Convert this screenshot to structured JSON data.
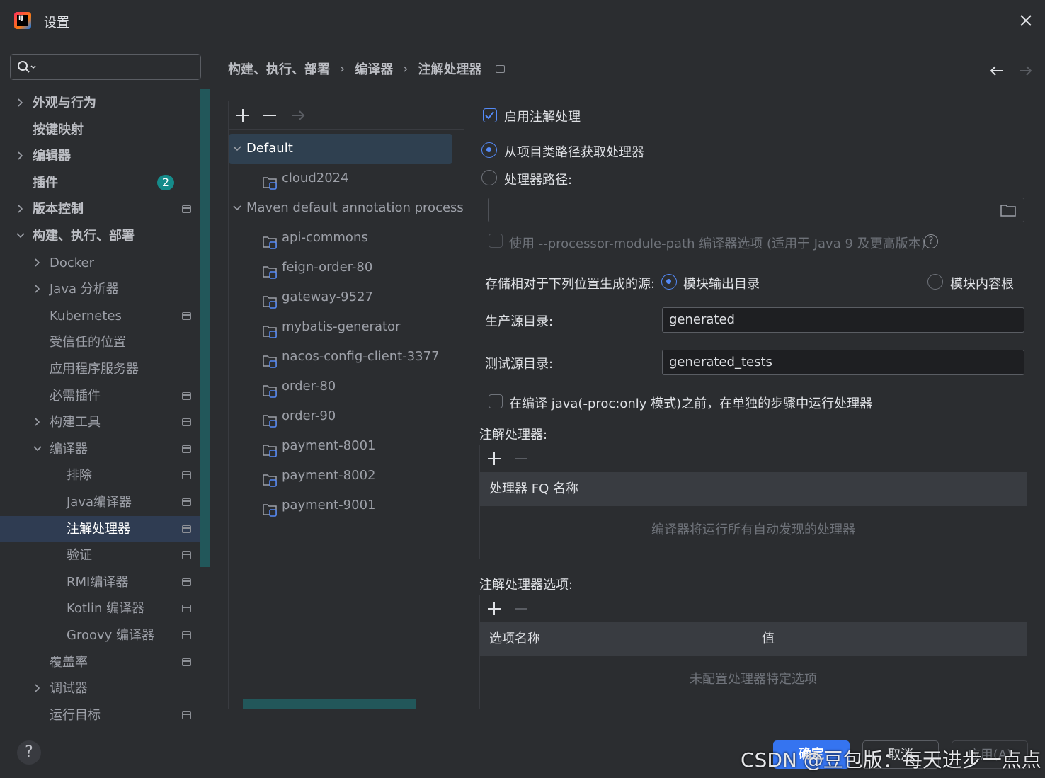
{
  "window": {
    "title": "设置",
    "app_icon": "intellij-idea-icon",
    "close_icon": "close-icon"
  },
  "colors": {
    "accent": "#3574f0",
    "badge": "#158b8a",
    "background": "#2b2d30",
    "selection": "#2f3c52"
  },
  "search": {
    "placeholder": "",
    "icon": "search-icon"
  },
  "sidebar": {
    "items": [
      {
        "label": "外观与行为",
        "expandable": true,
        "expanded": false,
        "level": 0
      },
      {
        "label": "按键映射",
        "expandable": false,
        "level": 0
      },
      {
        "label": "编辑器",
        "expandable": true,
        "expanded": false,
        "level": 0
      },
      {
        "label": "插件",
        "expandable": false,
        "level": 0,
        "badge": "2"
      },
      {
        "label": "版本控制",
        "expandable": true,
        "expanded": false,
        "level": 0,
        "pin": true
      },
      {
        "label": "构建、执行、部署",
        "expandable": true,
        "expanded": true,
        "level": 0
      },
      {
        "label": "Docker",
        "expandable": true,
        "expanded": false,
        "level": 1
      },
      {
        "label": "Java 分析器",
        "expandable": true,
        "expanded": false,
        "level": 1
      },
      {
        "label": "Kubernetes",
        "expandable": false,
        "level": 1,
        "pin": true
      },
      {
        "label": "受信任的位置",
        "expandable": false,
        "level": 1
      },
      {
        "label": "应用程序服务器",
        "expandable": false,
        "level": 1
      },
      {
        "label": "必需插件",
        "expandable": false,
        "level": 1,
        "pin": true
      },
      {
        "label": "构建工具",
        "expandable": true,
        "expanded": false,
        "level": 1,
        "pin": true
      },
      {
        "label": "编译器",
        "expandable": true,
        "expanded": true,
        "level": 1,
        "pin": true
      },
      {
        "label": "排除",
        "expandable": false,
        "level": 2,
        "pin": true
      },
      {
        "label": "Java编译器",
        "expandable": false,
        "level": 2,
        "pin": true
      },
      {
        "label": "注解处理器",
        "expandable": false,
        "level": 2,
        "pin": true,
        "selected": true
      },
      {
        "label": "验证",
        "expandable": false,
        "level": 2,
        "pin": true
      },
      {
        "label": "RMI编译器",
        "expandable": false,
        "level": 2,
        "pin": true
      },
      {
        "label": "Kotlin 编译器",
        "expandable": false,
        "level": 2,
        "pin": true
      },
      {
        "label": "Groovy 编译器",
        "expandable": false,
        "level": 2,
        "pin": true
      },
      {
        "label": "覆盖率",
        "expandable": false,
        "level": 1,
        "pin": true
      },
      {
        "label": "调试器",
        "expandable": true,
        "expanded": false,
        "level": 1
      },
      {
        "label": "运行目标",
        "expandable": false,
        "level": 1,
        "pin": true
      }
    ]
  },
  "breadcrumb": {
    "items": [
      "构建、执行、部署",
      "编译器",
      "注解处理器"
    ],
    "separator": "›"
  },
  "nav": {
    "back_icon": "arrow-left-icon",
    "forward_icon": "arrow-right-icon"
  },
  "profiles": {
    "toolbar": [
      "plus-icon",
      "minus-icon",
      "move-arrow-icon"
    ],
    "rows": [
      {
        "label": "Default",
        "type": "group",
        "expanded": true,
        "selected": true
      },
      {
        "label": "cloud2024",
        "type": "module"
      },
      {
        "label": "Maven default annotation processor",
        "type": "group",
        "expanded": true
      },
      {
        "label": "api-commons",
        "type": "module"
      },
      {
        "label": "feign-order-80",
        "type": "module"
      },
      {
        "label": "gateway-9527",
        "type": "module"
      },
      {
        "label": "mybatis-generator",
        "type": "module"
      },
      {
        "label": "nacos-config-client-3377",
        "type": "module"
      },
      {
        "label": "order-80",
        "type": "module"
      },
      {
        "label": "order-90",
        "type": "module"
      },
      {
        "label": "payment-8001",
        "type": "module"
      },
      {
        "label": "payment-8002",
        "type": "module"
      },
      {
        "label": "payment-9001",
        "type": "module"
      }
    ]
  },
  "settings": {
    "enable_processing": {
      "label": "启用注解处理",
      "checked": true
    },
    "obtain_from_classpath": {
      "label": "从项目类路径获取处理器",
      "selected": true
    },
    "processor_path": {
      "label": "处理器路径:",
      "selected": false,
      "value": ""
    },
    "module_path_option": {
      "label": "使用 --processor-module-path 编译器选项 (适用于 Java 9 及更高版本)",
      "checked": false,
      "enabled": false
    },
    "store_relative": {
      "label": "存储相对于下列位置生成的源:",
      "option_output": "模块输出目录",
      "option_content_root": "模块内容根",
      "selected": "模块输出目录"
    },
    "prod_dir": {
      "label": "生产源目录:",
      "value": "generated"
    },
    "test_dir": {
      "label": "测试源目录:",
      "value": "generated_tests"
    },
    "run_separately": {
      "label": "在编译 java(-proc:only 模式)之前，在单独的步骤中运行处理器",
      "checked": false
    },
    "processors_table": {
      "title": "注解处理器:",
      "column": "处理器 FQ 名称",
      "empty_text": "编译器将运行所有自动发现的处理器"
    },
    "options_table": {
      "title": "注解处理器选项:",
      "columns": [
        "选项名称",
        "值"
      ],
      "empty_text": "未配置处理器特定选项"
    }
  },
  "buttons": {
    "ok": "确定",
    "cancel": "取消",
    "apply": "应用(A)"
  },
  "watermark": "CSDN @豆包版：每天进步一点点"
}
